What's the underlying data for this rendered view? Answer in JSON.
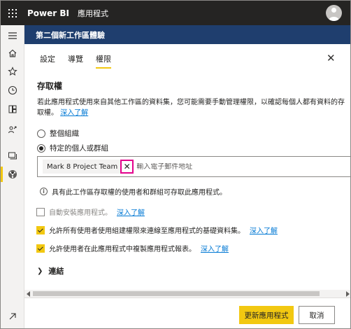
{
  "topbar": {
    "brand": "Power BI",
    "app_name": "應用程式"
  },
  "workspace": {
    "title": "第二個新工作區體驗"
  },
  "tabs": [
    {
      "label": "設定",
      "active": false
    },
    {
      "label": "導覽",
      "active": false
    },
    {
      "label": "權限",
      "active": true
    }
  ],
  "access": {
    "title": "存取權",
    "description": "若此應用程式使用來自其他工作區的資料集，您可能需要手動管理權限，以確認每個人都有資料的存取權。",
    "learn_more": "深入了解",
    "options": [
      {
        "label": "整個組織",
        "selected": false
      },
      {
        "label": "特定的個人或群組",
        "selected": true
      }
    ],
    "chip_label": "Mark 8 Project Team",
    "email_placeholder": "輸入電子郵件地址",
    "info_text": "具有此工作區存取權的使用者和群組可存取此應用程式。"
  },
  "checkboxes": [
    {
      "label": "自動安裝應用程式。",
      "link": "深入了解",
      "checked": false,
      "disabled": true
    },
    {
      "label": "允許所有使用者使用組建權限來連線至應用程式的基礎資料集。",
      "link": "深入了解",
      "checked": true,
      "disabled": false
    },
    {
      "label": "允許使用者在此應用程式中複製應用程式報表。",
      "link": "深入了解",
      "checked": true,
      "disabled": false
    }
  ],
  "connections_label": "連結",
  "footer": {
    "primary_label": "更新應用程式",
    "secondary_label": "取消"
  },
  "colors": {
    "accent": "#f2c811",
    "header": "#1f3e6e",
    "topbar": "#252423",
    "link": "#0078d4",
    "highlight": "#e3008c"
  },
  "icons": [
    "waffle-icon",
    "avatar-icon",
    "hamburger-icon",
    "home-icon",
    "star-icon",
    "clock-icon",
    "apps-icon",
    "shared-icon",
    "workspaces-icon",
    "current-workspace-icon",
    "expand-icon",
    "close-icon",
    "info-icon",
    "chevron-right-icon"
  ]
}
